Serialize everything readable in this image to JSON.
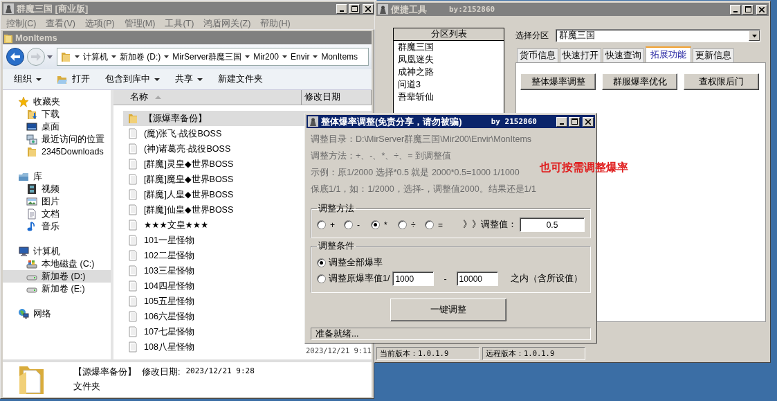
{
  "app_window": {
    "title": "群魔三国 [商业版]",
    "active": false,
    "menu": [
      "控制(C)",
      "查看(V)",
      "选项(P)",
      "管理(M)",
      "工具(T)",
      "鸿盾网关(Z)",
      "帮助(H)"
    ]
  },
  "explorer": {
    "title": "MonItems",
    "active": false,
    "breadcrumb": [
      "计算机",
      "新加卷 (D:)",
      "MirServer群魔三国",
      "Mir200",
      "Envir",
      "MonItems"
    ],
    "toolbar": [
      {
        "label": "组织",
        "kind": "menu"
      },
      {
        "label": "打开",
        "kind": "open"
      },
      {
        "label": "包含到库中",
        "kind": "menu"
      },
      {
        "label": "共享",
        "kind": "menu"
      },
      {
        "label": "新建文件夹",
        "kind": "plain"
      }
    ],
    "nav": [
      {
        "label": "收藏夹",
        "kind": "star",
        "selected": false,
        "children": [
          {
            "label": "下载",
            "kind": "download",
            "selected": false
          },
          {
            "label": "桌面",
            "kind": "desktop",
            "selected": false
          },
          {
            "label": "最近访问的位置",
            "kind": "recent",
            "selected": false
          },
          {
            "label": "2345Downloads",
            "kind": "folder",
            "selected": false
          }
        ]
      },
      {
        "label": "库",
        "kind": "library",
        "selected": false,
        "children": [
          {
            "label": "视频",
            "kind": "video",
            "selected": false
          },
          {
            "label": "图片",
            "kind": "image",
            "selected": false
          },
          {
            "label": "文档",
            "kind": "document",
            "selected": false
          },
          {
            "label": "音乐",
            "kind": "music",
            "selected": false
          }
        ]
      },
      {
        "label": "计算机",
        "kind": "computer",
        "selected": false,
        "children": [
          {
            "label": "本地磁盘 (C:)",
            "kind": "system-drive",
            "selected": false
          },
          {
            "label": "新加卷 (D:)",
            "kind": "drive",
            "selected": true
          },
          {
            "label": "新加卷 (E:)",
            "kind": "drive",
            "selected": false
          }
        ]
      },
      {
        "label": "网络",
        "kind": "network",
        "selected": false
      }
    ],
    "columns": [
      "名称",
      "修改日期"
    ],
    "files": [
      {
        "name": "【源爆率备份】",
        "kind": "folder",
        "selected": true
      },
      {
        "name": "(魔)张飞·战役BOSS",
        "kind": "file",
        "selected": false
      },
      {
        "name": "(神)诸葛亮·战役BOSS",
        "kind": "file",
        "selected": false
      },
      {
        "name": "[群魔]灵皇◆世界BOSS",
        "kind": "file",
        "selected": false
      },
      {
        "name": "[群魔]魔皇◆世界BOSS",
        "kind": "file",
        "selected": false
      },
      {
        "name": "[群魔]人皇◆世界BOSS",
        "kind": "file",
        "selected": false
      },
      {
        "name": "[群魔]仙皇◆世界BOSS",
        "kind": "file",
        "selected": false
      },
      {
        "name": "★★★文皇★★★",
        "kind": "file",
        "selected": false
      },
      {
        "name": "101一星怪物",
        "kind": "file",
        "selected": false
      },
      {
        "name": "102二星怪物",
        "kind": "file",
        "selected": false
      },
      {
        "name": "103三星怪物",
        "kind": "file",
        "selected": false
      },
      {
        "name": "104四星怪物",
        "kind": "file",
        "selected": false
      },
      {
        "name": "105五星怪物",
        "kind": "file",
        "selected": false
      },
      {
        "name": "106六星怪物",
        "kind": "file",
        "selected": false
      },
      {
        "name": "107七星怪物",
        "kind": "file",
        "selected": false
      },
      {
        "name": "108八星怪物",
        "kind": "file",
        "selected": false,
        "modified": "2023/12/21 9:11"
      }
    ],
    "details": {
      "name": "【源爆率备份】",
      "modified_label": "修改日期:",
      "modified": "2023/12/21 9:28",
      "type": "文件夹"
    }
  },
  "tool_window": {
    "title": "便捷工具",
    "by": "by:2152860",
    "active": false,
    "partition_list": {
      "header": "分区列表",
      "items": [
        "群魔三国",
        "凤凰迷失",
        "成神之路",
        "问道3",
        "吾辈斩仙"
      ]
    },
    "select_label": "选择分区",
    "select_value": "群魔三国",
    "tabs": [
      {
        "label": "货币信息",
        "selected": false
      },
      {
        "label": "快速打开",
        "selected": false
      },
      {
        "label": "快速查询",
        "selected": false
      },
      {
        "label": "拓展功能",
        "selected": true
      },
      {
        "label": "更新信息",
        "selected": false
      }
    ],
    "buttons": [
      "整体爆率调整",
      "群服爆率优化",
      "查权限后门"
    ],
    "status": [
      "当前版本：1.0.1.9",
      "远程版本：1.0.1.9"
    ]
  },
  "dialog": {
    "title": "整体爆率调整(免责分享，请勿被骗)",
    "by": "by 2152860",
    "active": true,
    "info": [
      "调整目录：D:\\MirServer群魔三国\\Mir200\\Envir\\MonItems",
      "调整方法：+、-、*、÷、=   到调整值",
      "示例：原1/2000 选择*0.5 就是 2000*0.5=1000  1/1000",
      "保底1/1，如：1/2000，选择-，调整值2000。结果还是1/1"
    ],
    "method": {
      "title": "调整方法",
      "options": [
        {
          "label": "+",
          "selected": false
        },
        {
          "label": "-",
          "selected": false
        },
        {
          "label": "*",
          "selected": true
        },
        {
          "label": "÷",
          "selected": false
        },
        {
          "label": "=",
          "selected": false
        }
      ],
      "value_label": "》》调整值：",
      "value": "0.5"
    },
    "condition": {
      "title": "调整条件",
      "options": [
        {
          "kind": "plain",
          "label": "调整全部爆率",
          "selected": true
        },
        {
          "kind": "range",
          "label": "调整原爆率值1/",
          "selected": false,
          "from": "1000",
          "separator": "-",
          "to": "10000",
          "suffix": "之内（含所设值）"
        }
      ]
    },
    "button": "一键调整",
    "status": "准备就绪..."
  },
  "annotation": "也可按需调整爆率"
}
